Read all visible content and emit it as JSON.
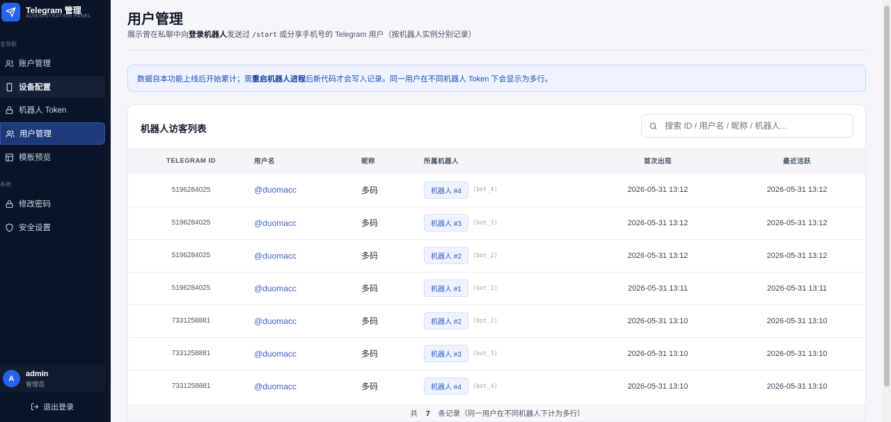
{
  "brand": {
    "title": "Telegram 管理",
    "subtitle": "ADMINISTRATION PANEL",
    "icon": "paper-plane-icon"
  },
  "sidebar": {
    "section_main": "主导航",
    "section_system": "系统",
    "items": [
      {
        "label": "账户管理",
        "icon": "users-icon"
      },
      {
        "label": "设备配置",
        "icon": "device-icon"
      },
      {
        "label": "机器人 Token",
        "icon": "lock-icon"
      },
      {
        "label": "用户管理",
        "icon": "users-icon"
      },
      {
        "label": "模板预览",
        "icon": "layout-icon"
      },
      {
        "label": "修改密码",
        "icon": "lock-icon"
      },
      {
        "label": "安全设置",
        "icon": "shield-icon"
      }
    ],
    "user": {
      "initial": "A",
      "name": "admin",
      "role": "管理员"
    },
    "logout": "退出登录"
  },
  "page": {
    "title": "用户管理",
    "sub_1": "展示曾在私聊中向",
    "sub_bold": "登录机器人",
    "sub_2": "发送过",
    "sub_code": "/start",
    "sub_3": "或分享手机号的 Telegram 用户（按机器人实例分别记录）"
  },
  "notice": {
    "part1": "数据自本功能上线后开始累计；需",
    "bold": "重启机器人进程",
    "part2": "后新代码才会写入记录。同一用户在不同机器人 Token 下会显示为多行。"
  },
  "card": {
    "title": "机器人访客列表",
    "search_placeholder": "搜索 ID / 用户名 / 昵称 / 机器人..."
  },
  "table": {
    "headers": [
      "TELEGRAM ID",
      "用户名",
      "昵称",
      "所属机器人",
      "首次出现",
      "最近活跃"
    ],
    "rows": [
      {
        "id": "5196284025",
        "username": "@duomacc",
        "nickname": "多码",
        "bot": "机器人 #4",
        "bot_key": "(bot_4)",
        "first_seen": "2026-05-31 13:12",
        "last_active": "2026-05-31 13:12"
      },
      {
        "id": "5196284025",
        "username": "@duomacc",
        "nickname": "多码",
        "bot": "机器人 #3",
        "bot_key": "(bot_3)",
        "first_seen": "2026-05-31 13:12",
        "last_active": "2026-05-31 13:12"
      },
      {
        "id": "5196284025",
        "username": "@duomacc",
        "nickname": "多码",
        "bot": "机器人 #2",
        "bot_key": "(bot_2)",
        "first_seen": "2026-05-31 13:12",
        "last_active": "2026-05-31 13:12"
      },
      {
        "id": "5196284025",
        "username": "@duomacc",
        "nickname": "多码",
        "bot": "机器人 #1",
        "bot_key": "(bot_1)",
        "first_seen": "2026-05-31 13:11",
        "last_active": "2026-05-31 13:11"
      },
      {
        "id": "7331258881",
        "username": "@duomacc",
        "nickname": "多码",
        "bot": "机器人 #2",
        "bot_key": "(bot_2)",
        "first_seen": "2026-05-31 13:10",
        "last_active": "2026-05-31 13:10"
      },
      {
        "id": "7331258881",
        "username": "@duomacc",
        "nickname": "多码",
        "bot": "机器人 #3",
        "bot_key": "(bot_3)",
        "first_seen": "2026-05-31 13:10",
        "last_active": "2026-05-31 13:10"
      },
      {
        "id": "7331258881",
        "username": "@duomacc",
        "nickname": "多码",
        "bot": "机器人 #4",
        "bot_key": "(bot_4)",
        "first_seen": "2026-05-31 13:10",
        "last_active": "2026-05-31 13:10"
      }
    ]
  },
  "footer": {
    "prefix": "共",
    "count": "7",
    "suffix": "条记录（同一用户在不同机器人下计为多行）"
  },
  "colors": {
    "accent": "#2563eb",
    "sidebar_bg": "#0b1428",
    "active_item": "#1e3a7a"
  }
}
